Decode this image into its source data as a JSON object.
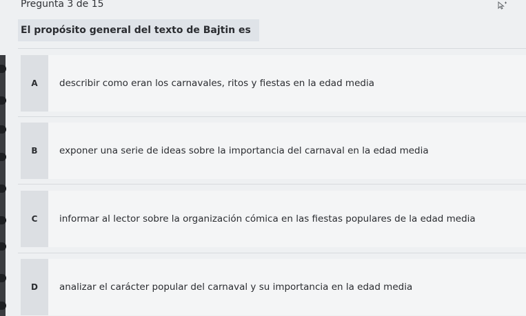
{
  "header": {
    "progress_label": "Pregunta 3 de 15"
  },
  "question": {
    "text": "El propósito general del texto de Bajtin es"
  },
  "options": [
    {
      "letter": "A",
      "text": "describir como eran los carnavales, ritos y fiestas en la edad media"
    },
    {
      "letter": "B",
      "text": "exponer una serie de ideas sobre la importancia del carnaval en la edad media"
    },
    {
      "letter": "C",
      "text": "informar al lector sobre la organización cómica en las fiestas populares de la edad media"
    },
    {
      "letter": "D",
      "text": "analizar el carácter popular del carnaval y su importancia en la edad media"
    }
  ],
  "icons": {
    "cursor": "cursor-icon"
  },
  "colors": {
    "background": "#eef0f2",
    "option_bg": "#f4f5f6",
    "letter_bg": "#dcdfe3"
  }
}
